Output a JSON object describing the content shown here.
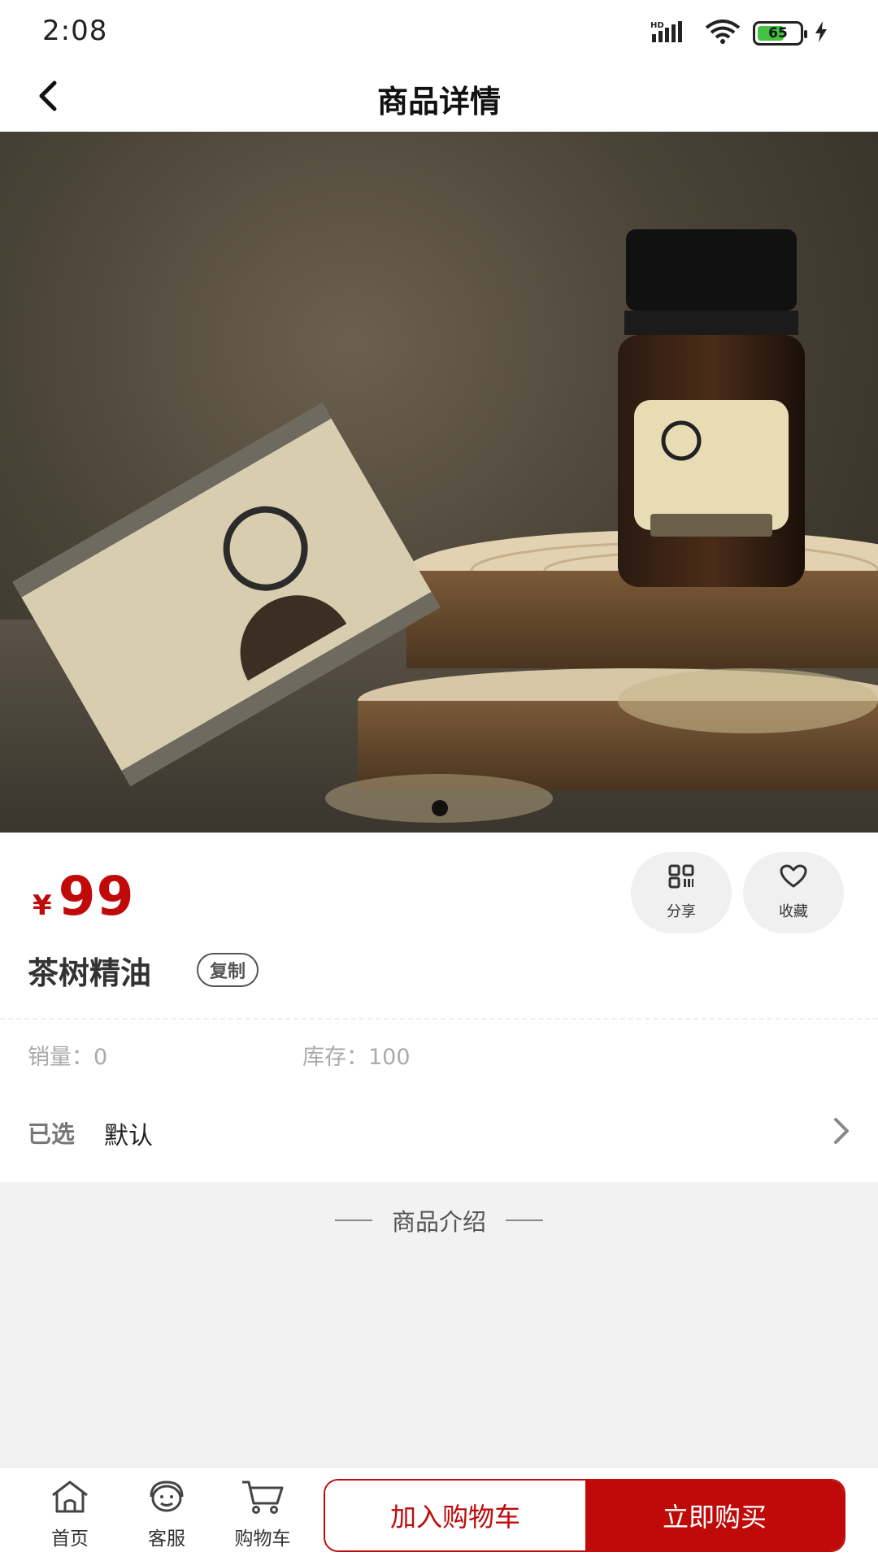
{
  "status_bar": {
    "time": "2:08",
    "battery_level": "65",
    "battery_fraction": 0.65,
    "icons": [
      "hd-signal-icon",
      "wifi-icon",
      "battery-icon",
      "charging-icon"
    ]
  },
  "header": {
    "title": "商品详情",
    "back_icon": "chevron-left-icon"
  },
  "carousel": {
    "slide_count": 1,
    "active_index": 0
  },
  "product": {
    "currency_symbol": "¥",
    "price": "99",
    "name": "茶树精油",
    "copy_label": "复制",
    "share_label": "分享",
    "favorite_label": "收藏",
    "sales": "销量：0",
    "stock": "库存：100",
    "selected_label": "已选",
    "selected_value": "默认"
  },
  "intro": {
    "title": "商品介绍"
  },
  "bottom_bar": {
    "tabs": [
      {
        "label": "首页",
        "icon": "home-icon"
      },
      {
        "label": "客服",
        "icon": "customer-service-icon"
      },
      {
        "label": "购物车",
        "icon": "cart-icon"
      }
    ],
    "add_to_cart": "加入购物车",
    "buy_now": "立即购买"
  },
  "colors": {
    "accent": "#c00a0a",
    "battery": "#42c142"
  }
}
